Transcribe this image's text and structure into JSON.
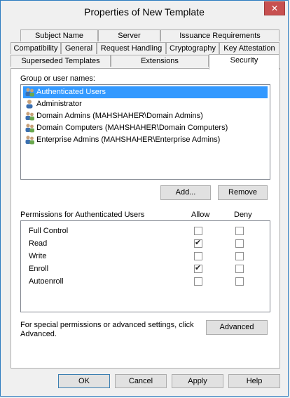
{
  "window": {
    "title": "Properties of New Template",
    "close_glyph": "✕"
  },
  "tabs_row1": [
    {
      "label": "Subject Name"
    },
    {
      "label": "Server"
    },
    {
      "label": "Issuance Requirements"
    }
  ],
  "tabs_row2": [
    {
      "label": "Compatibility"
    },
    {
      "label": "General"
    },
    {
      "label": "Request Handling"
    },
    {
      "label": "Cryptography"
    },
    {
      "label": "Key Attestation"
    }
  ],
  "tabs_row3": [
    {
      "label": "Superseded Templates"
    },
    {
      "label": "Extensions"
    },
    {
      "label": "Security"
    }
  ],
  "security": {
    "group_label": "Group or user names:",
    "users": [
      {
        "name": "Authenticated Users",
        "icon": "user-group-icon",
        "selected": true
      },
      {
        "name": "Administrator",
        "icon": "user-icon",
        "selected": false
      },
      {
        "name": "Domain Admins (MAHSHAHER\\Domain Admins)",
        "icon": "user-group-icon",
        "selected": false
      },
      {
        "name": "Domain Computers (MAHSHAHER\\Domain Computers)",
        "icon": "user-group-icon",
        "selected": false
      },
      {
        "name": "Enterprise Admins (MAHSHAHER\\Enterprise Admins)",
        "icon": "user-group-icon",
        "selected": false
      }
    ],
    "add_label": "Add...",
    "remove_label": "Remove",
    "permissions_label": "Permissions for Authenticated Users",
    "allow_header": "Allow",
    "deny_header": "Deny",
    "permissions": [
      {
        "name": "Full Control",
        "allow": false,
        "deny": false
      },
      {
        "name": "Read",
        "allow": true,
        "deny": false
      },
      {
        "name": "Write",
        "allow": false,
        "deny": false
      },
      {
        "name": "Enroll",
        "allow": true,
        "deny": false
      },
      {
        "name": "Autoenroll",
        "allow": false,
        "deny": false
      }
    ],
    "special_text_line1": "For special permissions or advanced settings, click",
    "special_text_line2": "Advanced.",
    "advanced_label": "Advanced"
  },
  "footer": {
    "ok_label": "OK",
    "cancel_label": "Cancel",
    "apply_label": "Apply",
    "help_label": "Help"
  }
}
